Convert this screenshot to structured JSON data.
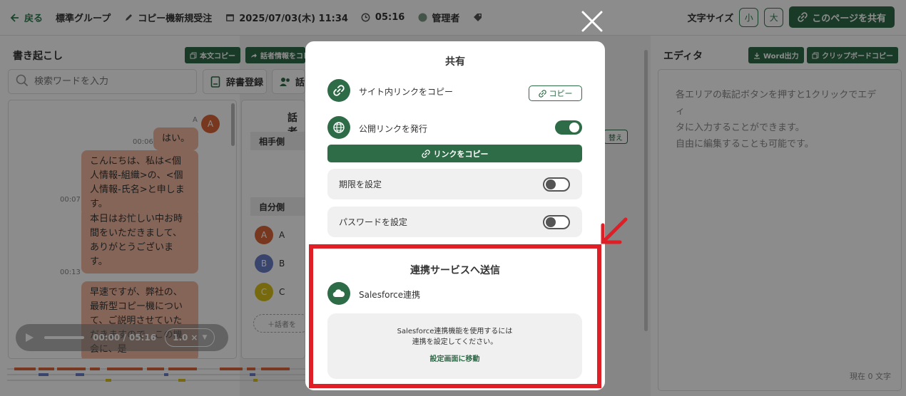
{
  "topbar": {
    "back_label": "戻る",
    "group": "標準グループ",
    "title": "コピー機新規受注",
    "datetime": "2025/07/03(木) 11:34",
    "duration": "05:16",
    "role": "管理者",
    "font_size_label": "文字サイズ",
    "font_small": "小",
    "font_large": "大",
    "share_button": "このページを共有"
  },
  "transcript": {
    "title": "書き起こし",
    "copy_text_button": "本文コピー",
    "speaker_info_button": "話者情報をコピー",
    "search_placeholder": "検索ワードを入力",
    "dictionary_button": "辞書登録",
    "speaker_button": "話者",
    "messages": [
      {
        "speaker": "A",
        "time": "00:06",
        "text": "はい。"
      },
      {
        "speaker": "A",
        "time": "00:07",
        "text": "こんにちは、私は<個人情報-組織>の、<個人情報-氏名>と申します。"
      },
      {
        "speaker": "A",
        "time": "00:13",
        "text": "本日はお忙しい中お時間をいただきまして、ありがとうございます。"
      },
      {
        "speaker": "A",
        "time": "",
        "text": "早速ですが、弊社の、最新型コピー機について、ご説明させていただきますので、この機会に、是"
      }
    ],
    "player": {
      "time": "00:00 / 05:16",
      "speed": "1.0"
    }
  },
  "speakers": {
    "title": "話者",
    "other_side": "相手側",
    "self_side": "自分側",
    "list": [
      {
        "name": "A",
        "color": "#d9673a"
      },
      {
        "name": "B",
        "color": "#6a7fc7"
      },
      {
        "name": "C",
        "color": "#d9c21a"
      }
    ],
    "add_label": "＋話者を"
  },
  "editor": {
    "title": "エディタ",
    "word_button": "Word出力",
    "clipboard_button": "クリップボードコピー",
    "placeholder_lines": [
      "各エリアの転記ボタンを押すと1クリックでエディ",
      "タに入力することができます。",
      "自由に編集することも可能です。"
    ],
    "char_count": "現在 0 文字"
  },
  "middle_snippet": {
    "switch_label": "替え"
  },
  "modal": {
    "title": "共有",
    "site_link_label": "サイト内リンクをコピー",
    "copy_button": "コピー",
    "public_link_label": "公開リンクを発行",
    "public_link_enabled": true,
    "link_copy_button": "リンクをコピー",
    "expiry_label": "期限を設定",
    "expiry_enabled": false,
    "password_label": "パスワードを設定",
    "password_enabled": false,
    "integration_title": "連携サービスへ送信",
    "salesforce_label": "Salesforce連携",
    "salesforce_message_1": "Salesforce連携機能を使用するには",
    "salesforce_message_2": "連携を設定してください。",
    "settings_link": "設定画面に移動"
  },
  "colors": {
    "brand_green": "#2e6b47",
    "highlight_red": "#e01e26",
    "bubble": "#f2b9a1"
  }
}
